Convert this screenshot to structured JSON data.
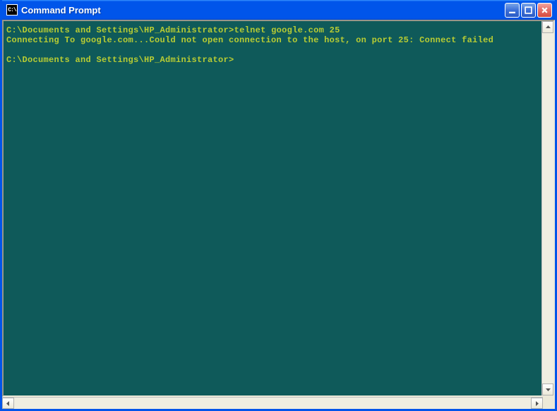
{
  "window": {
    "title": "Command Prompt",
    "app_icon_label": "C:\\"
  },
  "terminal": {
    "lines": [
      {
        "prompt": "C:\\Documents and Settings\\HP_Administrator>",
        "command": "telnet google.com 25"
      },
      {
        "output": "Connecting To google.com...Could not open connection to the host, on port 25: Connect failed"
      },
      {
        "blank": ""
      },
      {
        "prompt": "C:\\Documents and Settings\\HP_Administrator>",
        "command": ""
      }
    ]
  },
  "colors": {
    "console_bg": "#0f5a5a",
    "console_fg": "#b8cc33",
    "titlebar": "#0055ea"
  }
}
